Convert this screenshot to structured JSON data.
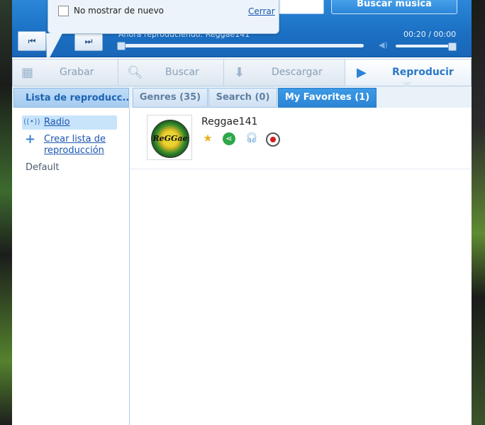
{
  "popup": {
    "checkbox_label": "No mostrar de nuevo",
    "close_link": "Cerrar"
  },
  "player": {
    "search_button": "Buscar música",
    "prev_icon": "skip-back-icon",
    "next_icon": "skip-forward-icon",
    "now_playing": "Ahora reproduciendo: Reggae141",
    "time": "00:20 / 00:00"
  },
  "toolbar": {
    "items": [
      {
        "label": "Grabar",
        "icon": "record-grid-icon"
      },
      {
        "label": "Buscar",
        "icon": "search-icon"
      },
      {
        "label": "Descargar",
        "icon": "download-icon"
      },
      {
        "label": "Reproducir",
        "icon": "play-icon"
      }
    ],
    "active": "Reproducir"
  },
  "sidebar": {
    "header": "Lista de reproducc...",
    "items": [
      {
        "label": "Radio",
        "icon": "radio-signal-icon",
        "selected": true
      },
      {
        "label": "Crear lista de reproducción",
        "icon": "plus-icon"
      },
      {
        "label": "Default"
      }
    ]
  },
  "tabs": [
    {
      "label": "Genres (35)",
      "active": false
    },
    {
      "label": "Search (0)",
      "active": false
    },
    {
      "label": "My Favorites (1)",
      "active": true
    }
  ],
  "favorites": [
    {
      "name": "Reggae141",
      "logo_text": "ReGGae",
      "actions": [
        "favorite-star-icon",
        "share-icon",
        "headphones-icon",
        "record-icon"
      ]
    }
  ],
  "colors": {
    "accent": "#2b84d4",
    "header_bg": "#1b6fc2",
    "link": "#1a56b0"
  }
}
